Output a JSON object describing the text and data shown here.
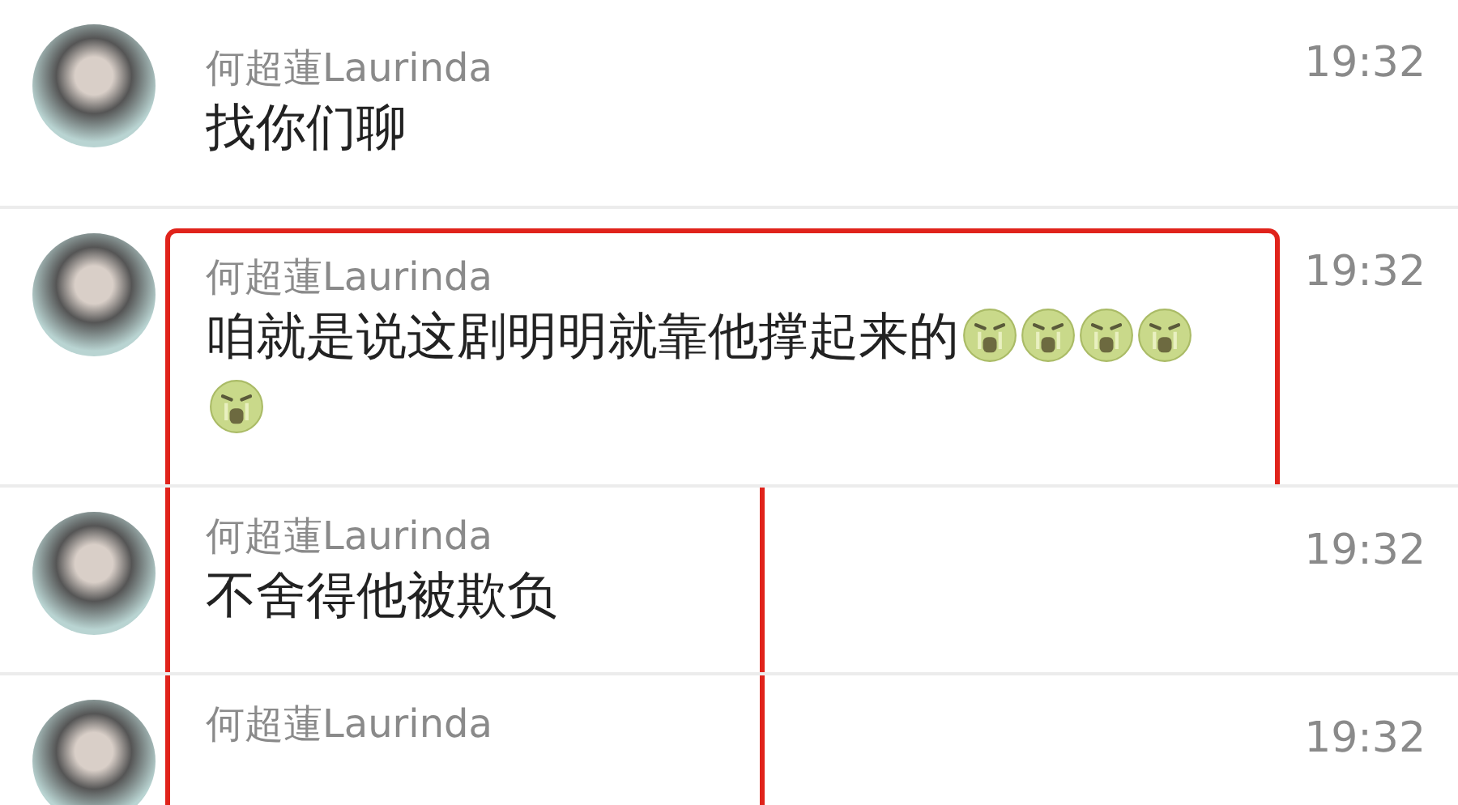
{
  "messages": [
    {
      "sender": "何超蓮Laurinda",
      "text": "找你们聊",
      "time": "19:32",
      "highlighted": false
    },
    {
      "sender": "何超蓮Laurinda",
      "text": "咱就是说这剧明明就靠他撑起来的",
      "time": "19:32",
      "highlighted": true,
      "emojis": [
        {
          "kind": "crying"
        },
        {
          "kind": "crying"
        },
        {
          "kind": "crying"
        },
        {
          "kind": "crying"
        },
        {
          "kind": "crying"
        }
      ]
    },
    {
      "sender": "何超蓮Laurinda",
      "text": "不舍得他被欺负",
      "time": "19:32",
      "highlighted": true
    },
    {
      "sender": "何超蓮Laurinda",
      "time": "19:32",
      "highlighted": true
    }
  ]
}
